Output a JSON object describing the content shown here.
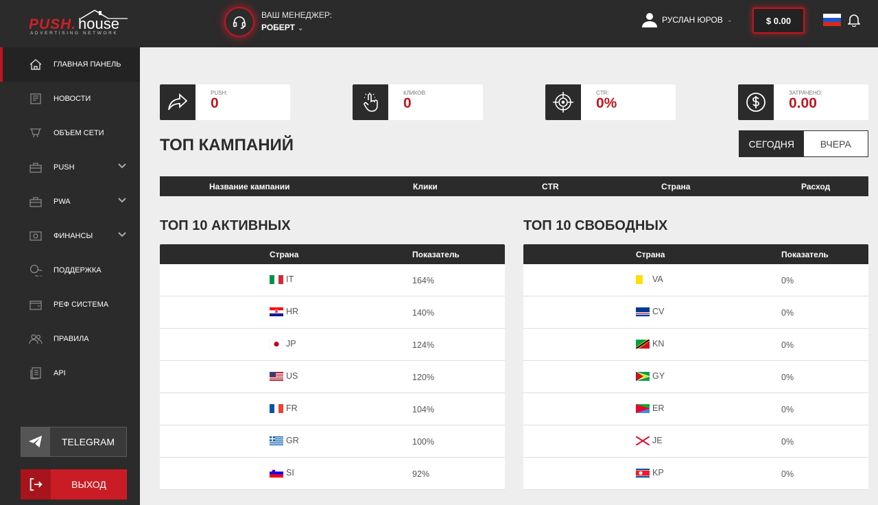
{
  "logo": {
    "word1": "PUSH.",
    "word2": "house",
    "sub": "ADVERTISING NETWORK"
  },
  "manager": {
    "label": "ВАШ МЕНЕДЖЕР:",
    "name": "РОБЕРТ"
  },
  "user": {
    "name": "РУСЛАН ЮРОВ"
  },
  "balance": "$ 0.00",
  "sidebar": {
    "items": [
      {
        "label": "ГЛАВНАЯ ПАНЕЛЬ",
        "icon": "home-icon",
        "active": true
      },
      {
        "label": "НОВОСТИ",
        "icon": "news-icon"
      },
      {
        "label": "ОБЪЕМ СЕТИ",
        "icon": "network-icon"
      },
      {
        "label": "PUSH",
        "icon": "briefcase-icon",
        "expandable": true
      },
      {
        "label": "PWA",
        "icon": "briefcase-icon",
        "expandable": true
      },
      {
        "label": "ФИНАНСЫ",
        "icon": "money-icon",
        "expandable": true
      },
      {
        "label": "ПОДДЕРЖКА",
        "icon": "chat-icon"
      },
      {
        "label": "РЕФ СИСТЕМА",
        "icon": "wallet-icon"
      },
      {
        "label": "ПРАВИЛА",
        "icon": "users-icon"
      },
      {
        "label": "API",
        "icon": "docs-icon"
      }
    ],
    "telegram": "TELEGRAM",
    "logout": "ВЫХОД"
  },
  "stats": [
    {
      "label": "PUSH:",
      "value": "0",
      "icon": "share-icon"
    },
    {
      "label": "КЛИКОВ:",
      "value": "0",
      "icon": "click-icon"
    },
    {
      "label": "CTR:",
      "value": "0%",
      "icon": "target-icon"
    },
    {
      "label": "ЗАТРАЧЕНО:",
      "value": "0.00",
      "icon": "dollar-icon"
    }
  ],
  "top_campaigns": {
    "title": "ТОП КАМПАНИЙ",
    "today": "СЕГОДНЯ",
    "yesterday": "ВЧЕРА",
    "columns": [
      "Название кампании",
      "Клики",
      "CTR",
      "Страна",
      "Расход"
    ]
  },
  "active": {
    "title": "ТОП 10 АКТИВНЫХ",
    "col_country": "Страна",
    "col_value": "Показатель",
    "rows": [
      {
        "code": "IT",
        "value": "164%"
      },
      {
        "code": "HR",
        "value": "140%"
      },
      {
        "code": "JP",
        "value": "124%"
      },
      {
        "code": "US",
        "value": "120%"
      },
      {
        "code": "FR",
        "value": "104%"
      },
      {
        "code": "GR",
        "value": "100%"
      },
      {
        "code": "SI",
        "value": "92%"
      }
    ]
  },
  "free": {
    "title": "ТОП 10 СВОБОДНЫХ",
    "col_country": "Страна",
    "col_value": "Показатель",
    "rows": [
      {
        "code": "VA",
        "value": "0%"
      },
      {
        "code": "CV",
        "value": "0%"
      },
      {
        "code": "KN",
        "value": "0%"
      },
      {
        "code": "GY",
        "value": "0%"
      },
      {
        "code": "ER",
        "value": "0%"
      },
      {
        "code": "JE",
        "value": "0%"
      },
      {
        "code": "KP",
        "value": "0%"
      }
    ]
  },
  "colors": {
    "accent": "#c0161f",
    "dark": "#2b2b2b",
    "bg": "#eeeeee"
  }
}
